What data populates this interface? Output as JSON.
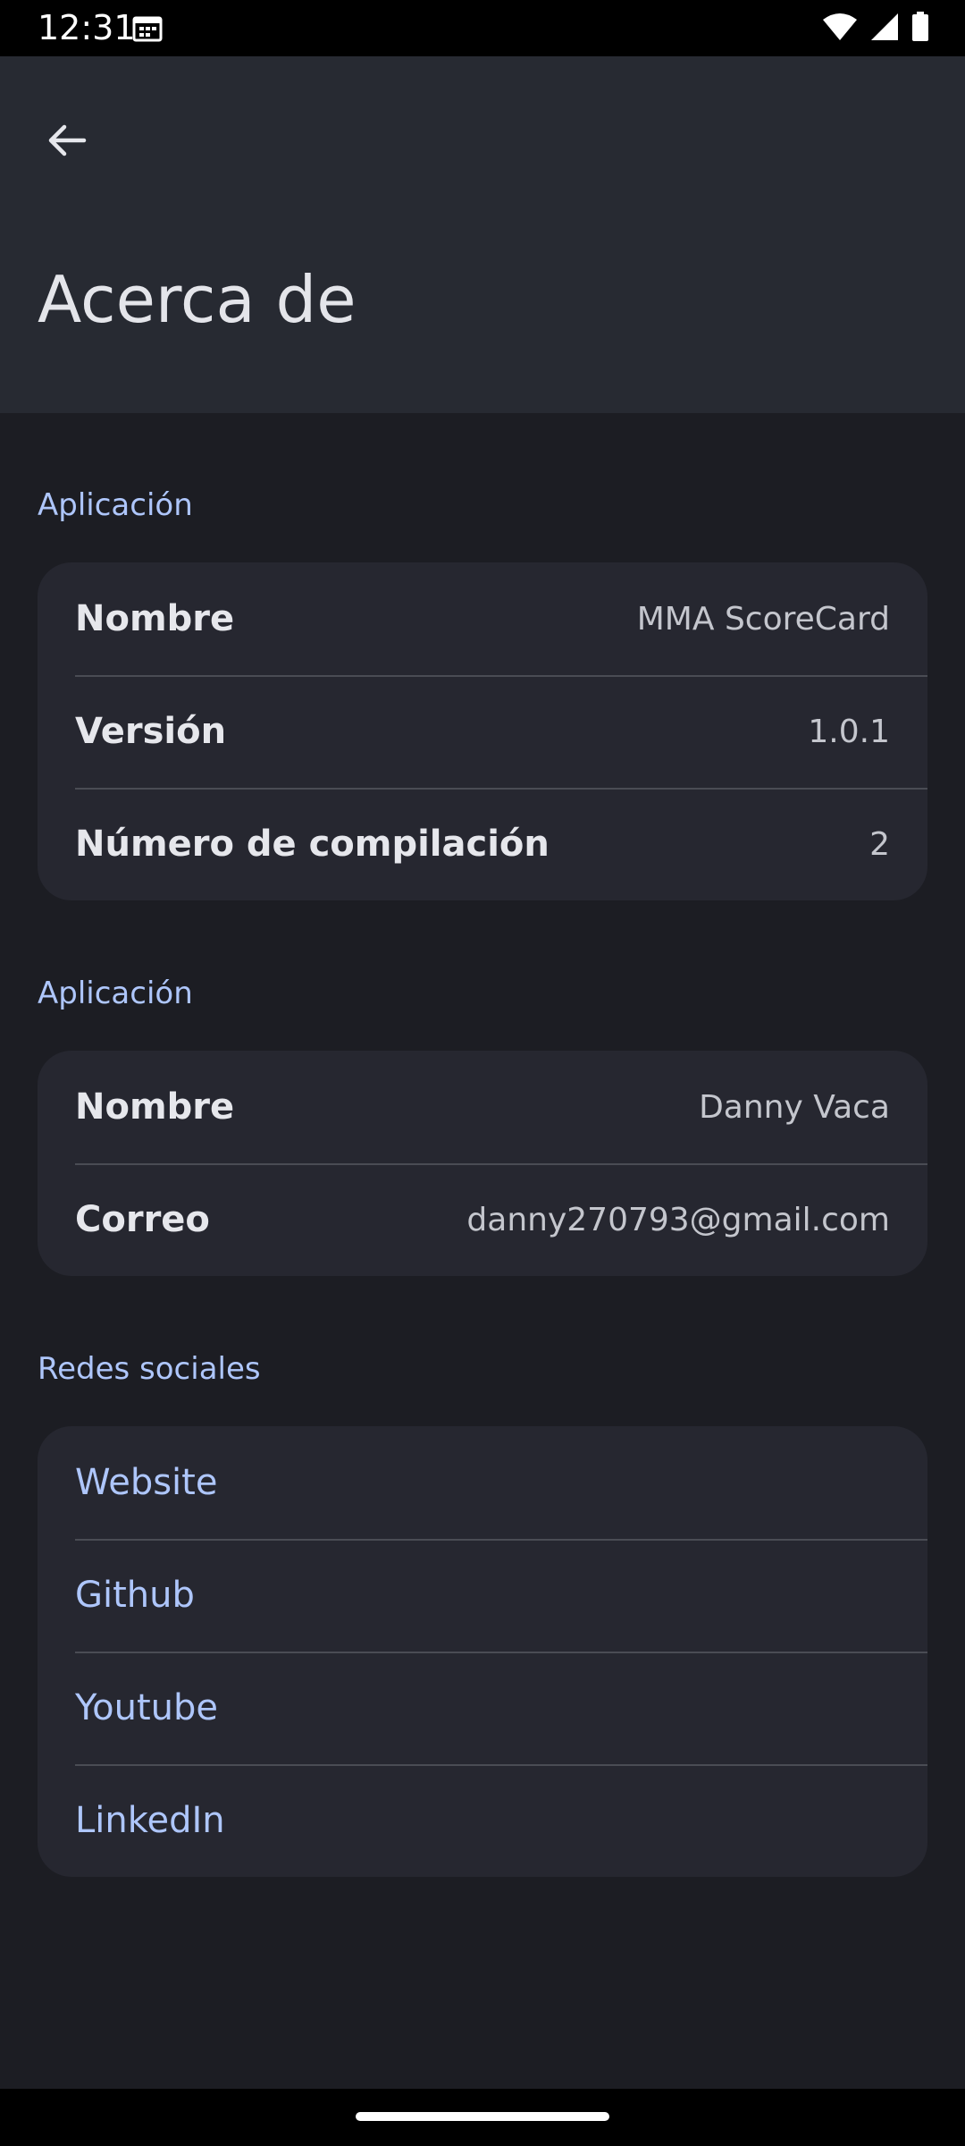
{
  "status_bar": {
    "time": "12:31",
    "icons": [
      "calendar-icon",
      "wifi-icon",
      "signal-icon",
      "battery-icon"
    ]
  },
  "header": {
    "back_icon": "arrow-back-icon",
    "title": "Acerca de"
  },
  "sections": {
    "app": {
      "header": "Aplicación",
      "rows": [
        {
          "label": "Nombre",
          "value": "MMA ScoreCard"
        },
        {
          "label": "Versión",
          "value": "1.0.1"
        },
        {
          "label": "Número de compilación",
          "value": "2"
        }
      ]
    },
    "developer": {
      "header": "Aplicación",
      "rows": [
        {
          "label": "Nombre",
          "value": "Danny Vaca"
        },
        {
          "label": "Correo",
          "value": "danny270793@gmail.com"
        }
      ]
    },
    "social": {
      "header": "Redes sociales",
      "links": [
        "Website",
        "Github",
        "Youtube",
        "LinkedIn"
      ]
    }
  },
  "colors": {
    "accent": "#aec6fb",
    "background": "#1c1d23",
    "app_bar": "#272a32",
    "card": "#262730"
  }
}
